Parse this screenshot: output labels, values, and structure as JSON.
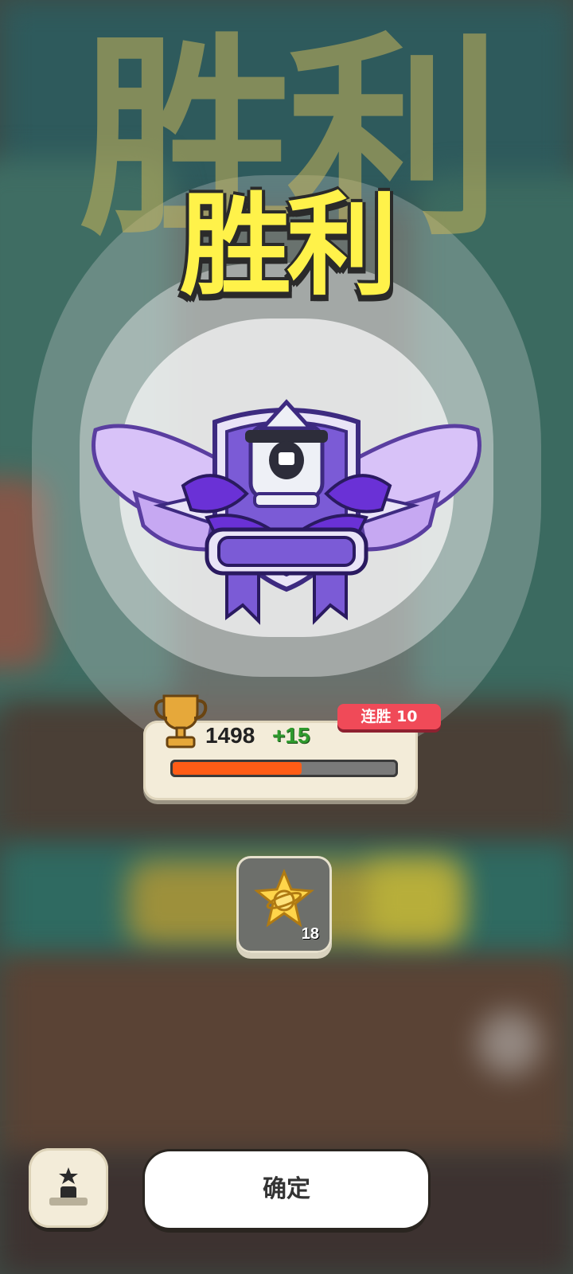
{
  "result": {
    "title": "胜利",
    "title_color": "#fff24a"
  },
  "rank_badge": {
    "icon": "winged-robot-shield-badge-icon",
    "primary_color": "#7b5bd6"
  },
  "score": {
    "points": "1498",
    "delta": "+15",
    "streak_label": "连胜 10",
    "progress_fraction": 0.58
  },
  "rewards": [
    {
      "icon": "planet-star-icon",
      "count": "18"
    }
  ],
  "buttons": {
    "confirm_label": "确定",
    "rank_icon": "podium-star-icon"
  }
}
